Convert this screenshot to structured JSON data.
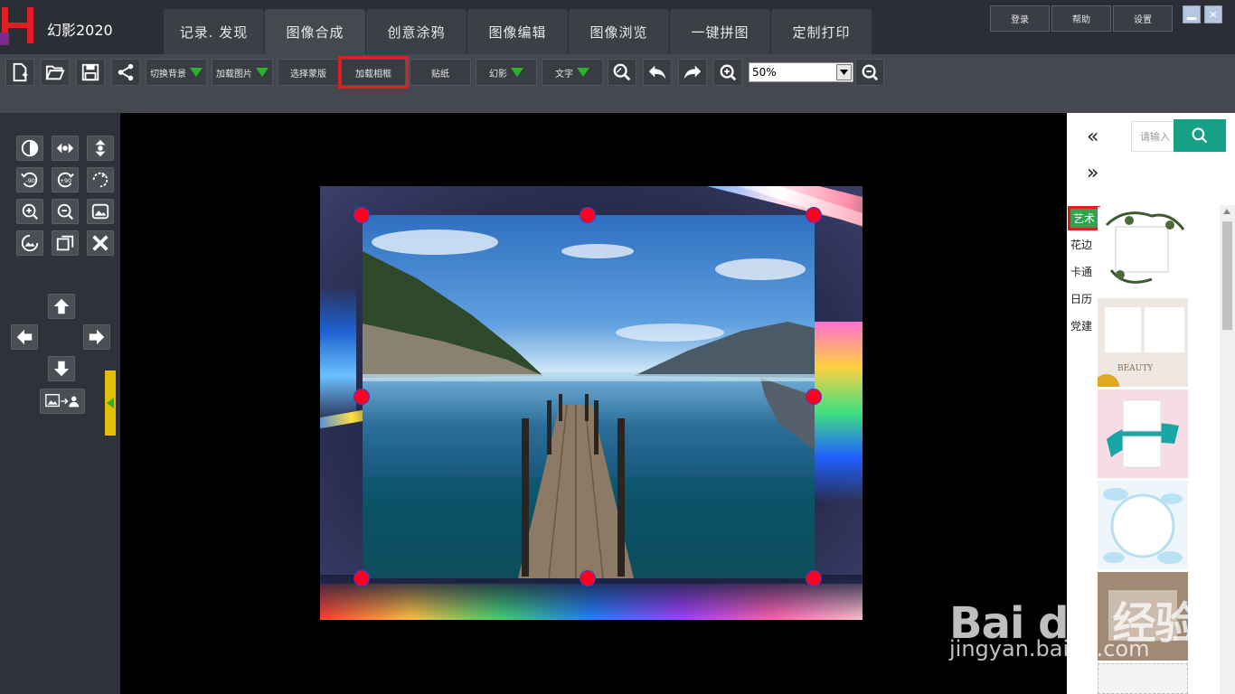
{
  "app": {
    "title": "幻影2020"
  },
  "main_tabs": [
    {
      "label": "记录. 发现"
    },
    {
      "label": "图像合成"
    },
    {
      "label": "创意涂鸦"
    },
    {
      "label": "图像编辑"
    },
    {
      "label": "图像浏览"
    },
    {
      "label": "一键拼图"
    },
    {
      "label": "定制打印"
    }
  ],
  "active_tab": "图像合成",
  "top_buttons": {
    "login": "登录",
    "help": "帮助",
    "settings": "设置"
  },
  "toolbar": {
    "switch_bg": "切换背景",
    "add_image": "加载图片",
    "select_template": "选择蒙版",
    "add_frame": "加载相框",
    "sticker": "贴纸",
    "illusion": "幻影",
    "text": "文字",
    "zoom_value": "50%"
  },
  "right_panel": {
    "search_placeholder": "请输入",
    "categories": [
      "艺术",
      "花边",
      "卡通",
      "日历",
      "党建"
    ],
    "active_category": "艺术",
    "thumb_text_beauty": "BEAUTY"
  },
  "watermark": {
    "brand": "Bai du 经验",
    "url": "jingyan.baidu.com"
  },
  "colors": {
    "accent_green": "#2bb12b",
    "search_button": "#16a085",
    "highlight_red": "#e02020",
    "handle_red": "#ff0022"
  }
}
